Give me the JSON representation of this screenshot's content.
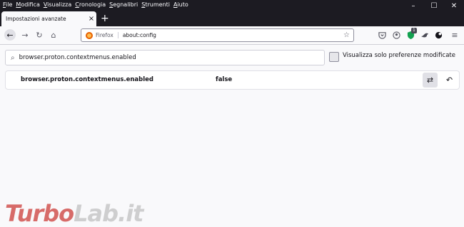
{
  "menubar": [
    "File",
    "Modifica",
    "Visualizza",
    "Cronologia",
    "Segnalibri",
    "Strumenti",
    "Aiuto"
  ],
  "tab": {
    "title": "Impostazioni avanzate",
    "close": "×"
  },
  "newtab": "+",
  "window_controls": {
    "minimize": "–",
    "maximize": "☐",
    "close": "✕"
  },
  "nav": {
    "back": "←",
    "forward": "→",
    "reload": "↻",
    "home": "⌂"
  },
  "urlbar": {
    "identity": "Firefox",
    "url": "about:config",
    "star": "☆"
  },
  "toolbar": {
    "badge": "1",
    "menu": "≡"
  },
  "search": {
    "value": "browser.proton.contextmenus.enabled",
    "icon": "⌕"
  },
  "filter": {
    "label": "Visualizza solo preferenze modificate",
    "checked": false
  },
  "pref": {
    "name": "browser.proton.contextmenus.enabled",
    "value": "false",
    "toggle": "⇄",
    "reset": "↶"
  },
  "watermark": {
    "part1": "Turbo",
    "part2": "Lab.it"
  }
}
